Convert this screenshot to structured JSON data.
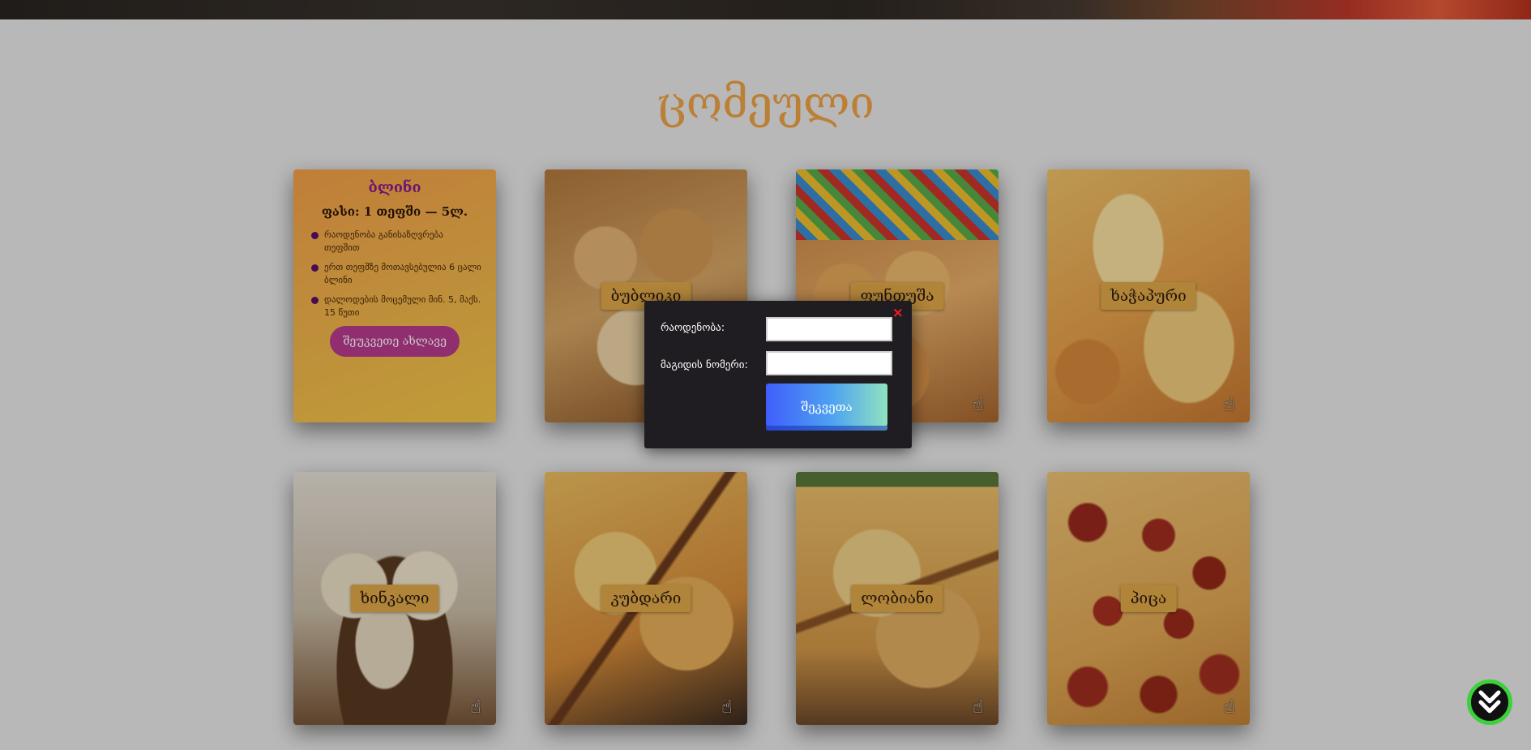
{
  "section": {
    "title": "ცომეული"
  },
  "info_card": {
    "title": "ბლინი",
    "price": "ფასი: 1 თეფში — 5ლ.",
    "items": [
      "რაოდენობა განისაზღვრება თეფშით",
      "ერთ თეფშზე მოთავსებულია 6 ცალი ბლინი",
      "დალოდების მოცემული მინ. 5, მაქს. 15 წუთი"
    ],
    "button_label": "შეუკვეთე ახლავე"
  },
  "products": [
    {
      "label": "ბუბლიკი"
    },
    {
      "label": "ფუნთუშა"
    },
    {
      "label": "ხაჭაპური"
    },
    {
      "label": "ხინკალი"
    },
    {
      "label": "კუბდარი"
    },
    {
      "label": "ლობიანი"
    },
    {
      "label": "პიცა"
    }
  ],
  "order_modal": {
    "quantity_label": "რაოდენობა:",
    "quantity_value": "",
    "table_label": "მაგიდის ნომერი:",
    "table_value": "",
    "submit_label": "შეკვეთა",
    "close_glyph": "×"
  },
  "colors": {
    "accent_title": "#f0a445",
    "label_bg": "#e2a94a",
    "info_title": "#8b1a8f",
    "modal_bg": "#1f1d21",
    "close_red": "#ff1a1a",
    "scroll_ring": "#3cd13c"
  },
  "icons": {
    "card_click": "hand-pointer-icon",
    "scroll": "double-chevron-down-icon",
    "bullet": "purple-dot-icon"
  }
}
